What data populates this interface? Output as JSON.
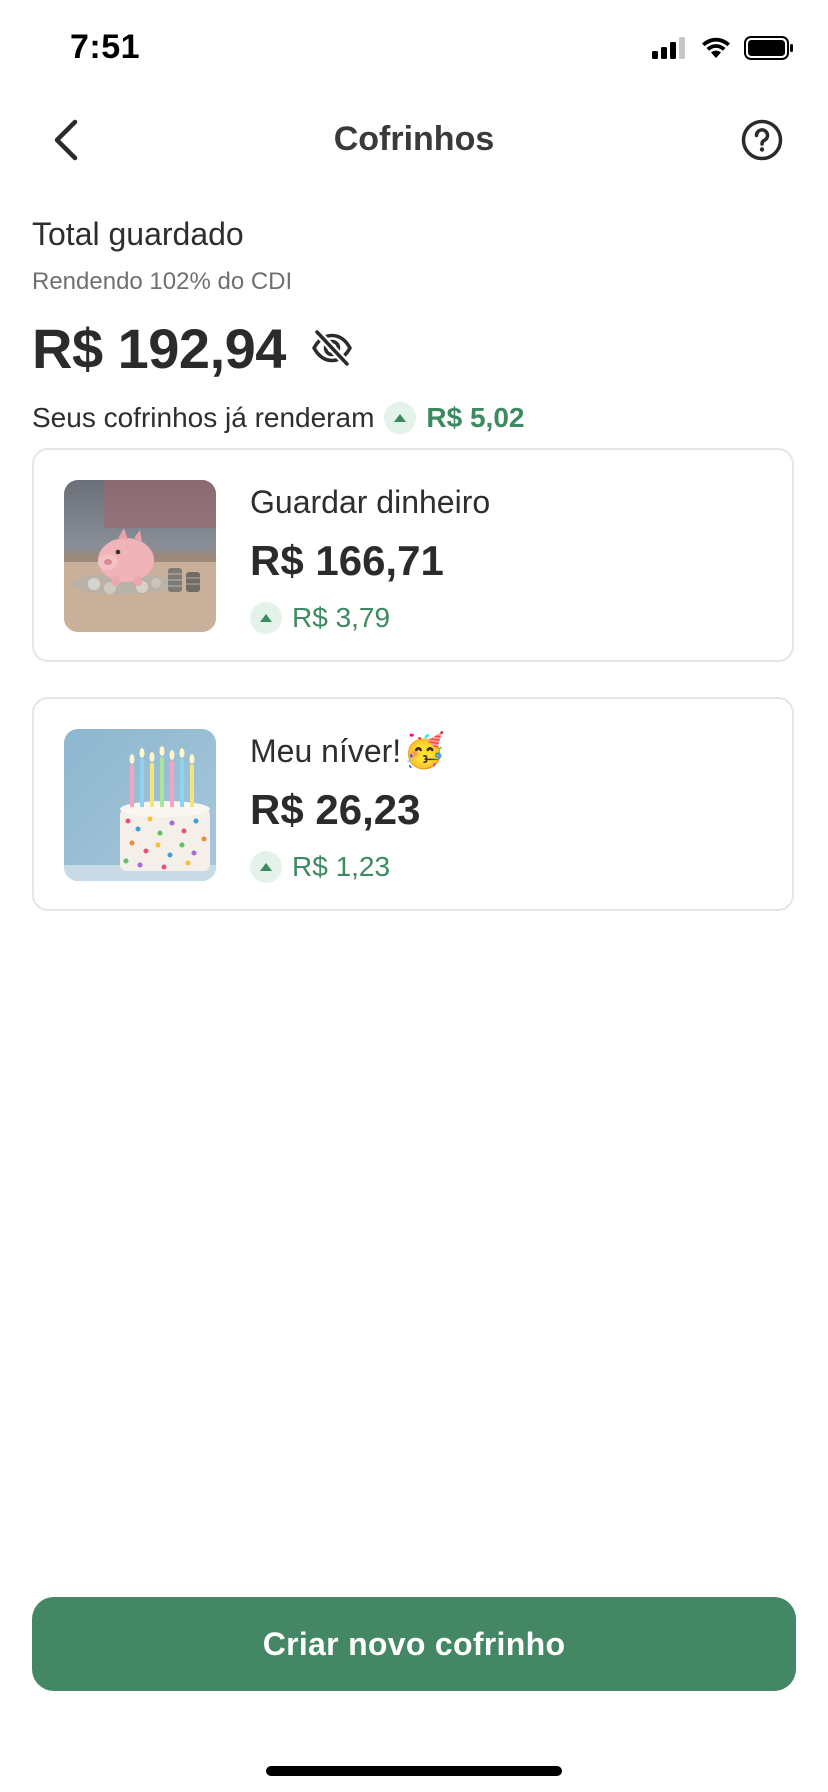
{
  "status_bar": {
    "time": "7:51"
  },
  "header": {
    "title": "Cofrinhos",
    "back_icon": "chevron-left-icon",
    "help_icon": "question-circle-icon"
  },
  "summary": {
    "total_label": "Total guardado",
    "yield_rate": "Rendendo 102% do CDI",
    "balance": "R$ 192,94",
    "visibility_icon": "eye-off-icon",
    "earned_label": "Seus cofrinhos já renderam",
    "earned_value": "R$ 5,02"
  },
  "savings": [
    {
      "name": "Guardar dinheiro",
      "emoji": "",
      "amount": "R$ 166,71",
      "yield": "R$ 3,79",
      "image": "piggy-bank-photo"
    },
    {
      "name": "Meu níver!",
      "emoji": "🥳",
      "amount": "R$ 26,23",
      "yield": "R$ 1,23",
      "image": "birthday-cake-photo"
    }
  ],
  "cta": {
    "label": "Criar novo cofrinho"
  },
  "colors": {
    "accent_green": "#438764",
    "positive_text": "#3c8a5f",
    "positive_badge_bg": "#e3f3ea",
    "card_border": "#e6e6e6"
  }
}
